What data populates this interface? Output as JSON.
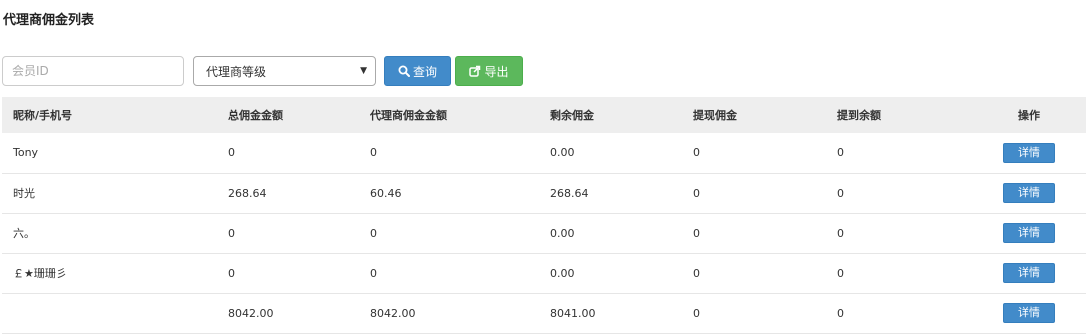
{
  "page": {
    "title": "代理商佣金列表"
  },
  "filters": {
    "member_id_placeholder": "会员ID",
    "level_select_value": "代理商等级",
    "query_label": "查询",
    "export_label": "导出"
  },
  "table": {
    "headers": [
      "昵称/手机号",
      "总佣金金额",
      "代理商佣金金额",
      "剩余佣金",
      "提现佣金",
      "提到余额",
      "操作"
    ],
    "rows": [
      {
        "name": "Tony",
        "total": "0",
        "agent": "0",
        "remaining": "0.00",
        "withdrawn": "0",
        "to_balance": "0",
        "action": "详情"
      },
      {
        "name": "时光",
        "total": "268.64",
        "agent": "60.46",
        "remaining": "268.64",
        "withdrawn": "0",
        "to_balance": "0",
        "action": "详情"
      },
      {
        "name": "六。",
        "total": "0",
        "agent": "0",
        "remaining": "0.00",
        "withdrawn": "0",
        "to_balance": "0",
        "action": "详情"
      },
      {
        "name": "￡★珊珊彡",
        "total": "0",
        "agent": "0",
        "remaining": "0.00",
        "withdrawn": "0",
        "to_balance": "0",
        "action": "详情"
      },
      {
        "name": "",
        "total": "8042.00",
        "agent": "8042.00",
        "remaining": "8041.00",
        "withdrawn": "0",
        "to_balance": "0",
        "action": "详情"
      }
    ]
  },
  "colors": {
    "primary": "#428bca",
    "success": "#5cb85c",
    "header_bg": "#eeeeee"
  }
}
